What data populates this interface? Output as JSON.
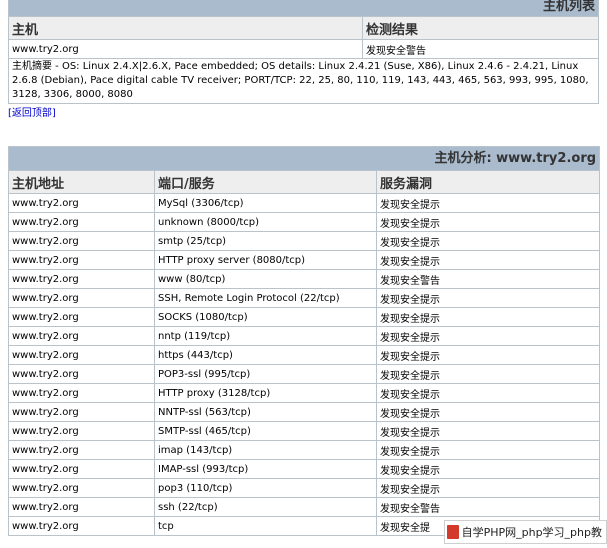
{
  "host_list": {
    "title": "主机列表",
    "headers": {
      "host": "主机",
      "result": "检测结果"
    },
    "row": {
      "host": "www.try2.org",
      "result": "发现安全警告"
    },
    "summary": "主机摘要 - OS: Linux 2.4.X|2.6.X, Pace embedded; OS details: Linux 2.4.21 (Suse, X86), Linux 2.4.6 - 2.4.21, Linux 2.6.8 (Debian), Pace digital cable TV receiver; PORT/TCP: 22, 25, 80, 110, 119, 143, 443, 465, 563, 993, 995, 1080, 3128, 3306, 8000, 8080"
  },
  "back_to_top": "[返回顶部]",
  "host_analysis": {
    "title": "主机分析: www.try2.org",
    "headers": {
      "address": "主机地址",
      "port": "端口/服务",
      "vuln": "服务漏洞"
    },
    "rows": [
      {
        "address": "www.try2.org",
        "port": "MySql (3306/tcp)",
        "vuln": "发现安全提示"
      },
      {
        "address": "www.try2.org",
        "port": "unknown (8000/tcp)",
        "vuln": "发现安全提示"
      },
      {
        "address": "www.try2.org",
        "port": "smtp (25/tcp)",
        "vuln": "发现安全提示"
      },
      {
        "address": "www.try2.org",
        "port": "HTTP proxy server (8080/tcp)",
        "vuln": "发现安全提示"
      },
      {
        "address": "www.try2.org",
        "port": "www (80/tcp)",
        "vuln": "发现安全警告"
      },
      {
        "address": "www.try2.org",
        "port": "SSH, Remote Login Protocol (22/tcp)",
        "vuln": "发现安全提示"
      },
      {
        "address": "www.try2.org",
        "port": "SOCKS (1080/tcp)",
        "vuln": "发现安全提示"
      },
      {
        "address": "www.try2.org",
        "port": "nntp (119/tcp)",
        "vuln": "发现安全提示"
      },
      {
        "address": "www.try2.org",
        "port": "https (443/tcp)",
        "vuln": "发现安全提示"
      },
      {
        "address": "www.try2.org",
        "port": "POP3-ssl (995/tcp)",
        "vuln": "发现安全提示"
      },
      {
        "address": "www.try2.org",
        "port": "HTTP proxy (3128/tcp)",
        "vuln": "发现安全提示"
      },
      {
        "address": "www.try2.org",
        "port": "NNTP-ssl (563/tcp)",
        "vuln": "发现安全提示"
      },
      {
        "address": "www.try2.org",
        "port": "SMTP-ssl (465/tcp)",
        "vuln": "发现安全提示"
      },
      {
        "address": "www.try2.org",
        "port": "imap (143/tcp)",
        "vuln": "发现安全提示"
      },
      {
        "address": "www.try2.org",
        "port": "IMAP-ssl (993/tcp)",
        "vuln": "发现安全提示"
      },
      {
        "address": "www.try2.org",
        "port": "pop3 (110/tcp)",
        "vuln": "发现安全提示"
      },
      {
        "address": "www.try2.org",
        "port": "ssh (22/tcp)",
        "vuln": "发现安全警告"
      },
      {
        "address": "www.try2.org",
        "port": "tcp",
        "vuln": "发现安全提"
      }
    ]
  },
  "watermark": "自学PHP网_php学习_php教"
}
